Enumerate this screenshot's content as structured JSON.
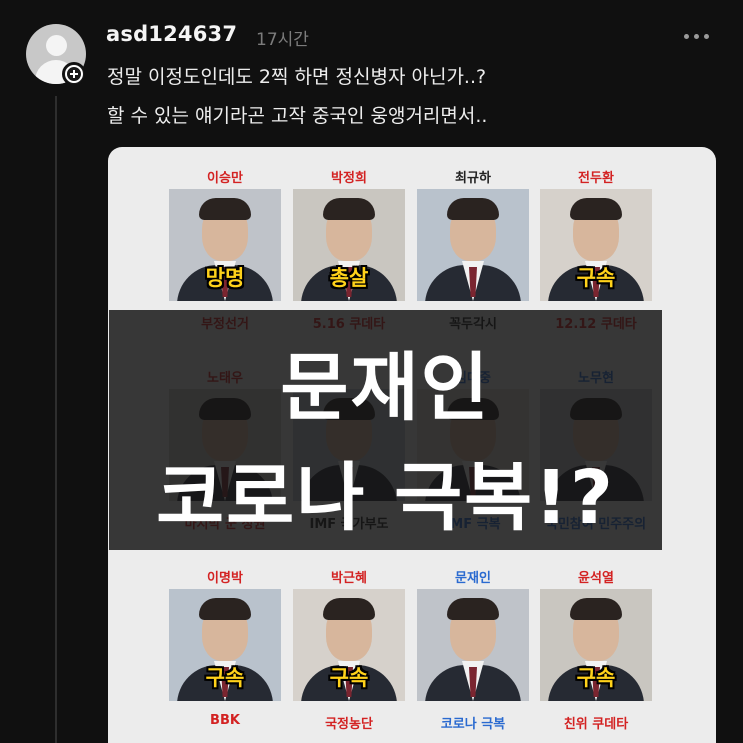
{
  "post": {
    "username": "asd124637",
    "time": "17시간",
    "lines": [
      "정말 이정도인데도 2찍 하면 정신병자 아닌가..?",
      "할 수 있는 얘기라곤 고작 중국인 웅앵거리면서.."
    ]
  },
  "image": {
    "rows": [
      [
        {
          "name": "이승만",
          "badge": "망명",
          "event": "부정선거",
          "name_color": "red",
          "event_color": "red"
        },
        {
          "name": "박정희",
          "badge": "총살",
          "event": "5.16 쿠데타",
          "name_color": "red",
          "event_color": "red"
        },
        {
          "name": "최규하",
          "badge": "",
          "event": "꼭두각시",
          "name_color": "dark",
          "event_color": "dark"
        },
        {
          "name": "전두환",
          "badge": "구속",
          "event": "12.12 쿠데타",
          "name_color": "red",
          "event_color": "red"
        }
      ],
      [
        {
          "name": "노태우",
          "badge": "",
          "event": "마지막 군 정권",
          "name_color": "red",
          "event_color": "red"
        },
        {
          "name": "",
          "badge": "",
          "event": "IMF 국가부도",
          "name_color": "dark",
          "event_color": "dark"
        },
        {
          "name": "김대중",
          "badge": "",
          "event": "IMF 극복",
          "name_color": "blue",
          "event_color": "blue"
        },
        {
          "name": "노무현",
          "badge": "",
          "event": "국민참여 민주주의",
          "name_color": "blue",
          "event_color": "blue"
        }
      ],
      [
        {
          "name": "이명박",
          "badge": "구속",
          "event": "BBK",
          "name_color": "red",
          "event_color": "red"
        },
        {
          "name": "박근혜",
          "badge": "구속",
          "event": "국정농단",
          "name_color": "red",
          "event_color": "red"
        },
        {
          "name": "문재인",
          "badge": "",
          "event": "코로나 극복",
          "name_color": "blue",
          "event_color": "blue"
        },
        {
          "name": "윤석열",
          "badge": "구속",
          "event": "친위 쿠데타",
          "name_color": "red",
          "event_color": "red"
        }
      ]
    ],
    "overlay_line1": "문재인",
    "overlay_line2": "코로나 극복!?"
  },
  "icons": {
    "avatar": "default-user-avatar-icon",
    "follow": "plus-circle-icon",
    "more": "more-horizontal-icon"
  },
  "colors": {
    "background": "#101010",
    "red": "#d32222",
    "blue": "#2a6ad0",
    "badge": "#ffd21a"
  }
}
